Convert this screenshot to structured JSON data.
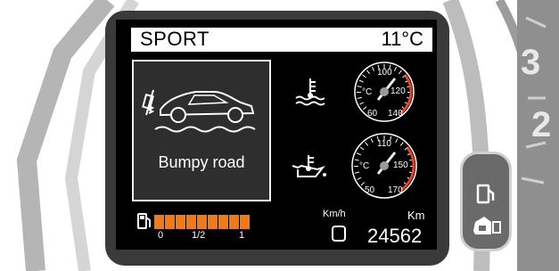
{
  "header": {
    "mode": "SPORT",
    "temperature": "11°C"
  },
  "panel": {
    "message": "Bumpy road",
    "icon": "car-suspension-icon"
  },
  "gauges": [
    {
      "name": "coolant",
      "icon": "coolant-temp-icon",
      "labels": [
        "100",
        "°C",
        "120",
        "60",
        "140"
      ],
      "accent": "#e8402a"
    },
    {
      "name": "oil",
      "icon": "oil-temp-icon",
      "labels": [
        "110",
        "°C",
        "150",
        "50",
        "170"
      ],
      "accent": "#e8402a"
    }
  ],
  "fuel": {
    "icon": "fuel-icon",
    "level": 0.95,
    "segments": 9,
    "ticks": [
      "0",
      "1/2",
      "1"
    ],
    "color": "#ee7a18"
  },
  "speed_unit": "Km/h",
  "odometer": {
    "unit": "Km",
    "value": "24562"
  },
  "cluster": {
    "digit_top": "3",
    "digit_bottom": "2"
  },
  "pod": {
    "icons": [
      "fuel-warning-icon",
      "fuel-door-icon"
    ]
  }
}
